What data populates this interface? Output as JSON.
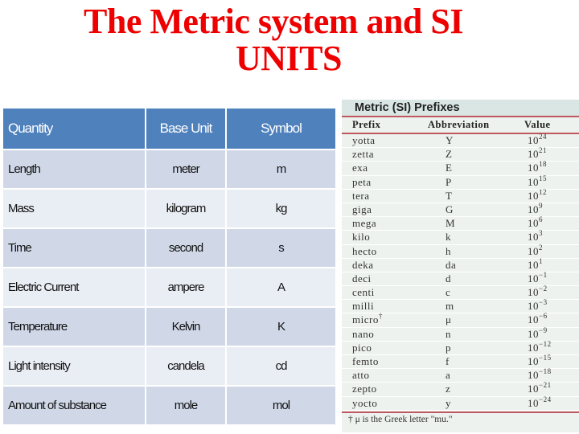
{
  "title": {
    "line1": "The Metric system and SI",
    "line2": "UNITS"
  },
  "colors": {
    "title": "#ee0000",
    "units_header": "#4f81bd",
    "row_dark": "#d0d8e8",
    "row_light": "#e9edf4",
    "prefix_rule": "#c0585f"
  },
  "units_table": {
    "headers": [
      "Quantity",
      "Base Unit",
      "Symbol"
    ],
    "rows": [
      [
        "Length",
        "meter",
        "m"
      ],
      [
        "Mass",
        "kilogram",
        "kg"
      ],
      [
        "Time",
        "second",
        "s"
      ],
      [
        "Electric Current",
        "ampere",
        "A"
      ],
      [
        "Temperature",
        "Kelvin",
        "K"
      ],
      [
        "Light intensity",
        "candela",
        "cd"
      ],
      [
        "Amount of substance",
        "mole",
        "mol"
      ]
    ]
  },
  "prefix_table": {
    "title": "Metric (SI) Prefixes",
    "headers": [
      "Prefix",
      "Abbreviation",
      "Value"
    ],
    "rows": [
      {
        "prefix": "yotta",
        "mark": "",
        "abbr": "Y",
        "base": "10",
        "exp": "24"
      },
      {
        "prefix": "zetta",
        "mark": "",
        "abbr": "Z",
        "base": "10",
        "exp": "21"
      },
      {
        "prefix": "exa",
        "mark": "",
        "abbr": "E",
        "base": "10",
        "exp": "18"
      },
      {
        "prefix": "peta",
        "mark": "",
        "abbr": "P",
        "base": "10",
        "exp": "15"
      },
      {
        "prefix": "tera",
        "mark": "",
        "abbr": "T",
        "base": "10",
        "exp": "12"
      },
      {
        "prefix": "giga",
        "mark": "",
        "abbr": "G",
        "base": "10",
        "exp": "9"
      },
      {
        "prefix": "mega",
        "mark": "",
        "abbr": "M",
        "base": "10",
        "exp": "6"
      },
      {
        "prefix": "kilo",
        "mark": "",
        "abbr": "k",
        "base": "10",
        "exp": "3"
      },
      {
        "prefix": "hecto",
        "mark": "",
        "abbr": "h",
        "base": "10",
        "exp": "2"
      },
      {
        "prefix": "deka",
        "mark": "",
        "abbr": "da",
        "base": "10",
        "exp": "1"
      },
      {
        "prefix": "deci",
        "mark": "",
        "abbr": "d",
        "base": "10",
        "exp": "−1"
      },
      {
        "prefix": "centi",
        "mark": "",
        "abbr": "c",
        "base": "10",
        "exp": "−2"
      },
      {
        "prefix": "milli",
        "mark": "",
        "abbr": "m",
        "base": "10",
        "exp": "−3"
      },
      {
        "prefix": "micro",
        "mark": "†",
        "abbr": "μ",
        "base": "10",
        "exp": "−6"
      },
      {
        "prefix": "nano",
        "mark": "",
        "abbr": "n",
        "base": "10",
        "exp": "−9"
      },
      {
        "prefix": "pico",
        "mark": "",
        "abbr": "p",
        "base": "10",
        "exp": "−12"
      },
      {
        "prefix": "femto",
        "mark": "",
        "abbr": "f",
        "base": "10",
        "exp": "−15"
      },
      {
        "prefix": "atto",
        "mark": "",
        "abbr": "a",
        "base": "10",
        "exp": "−18"
      },
      {
        "prefix": "zepto",
        "mark": "",
        "abbr": "z",
        "base": "10",
        "exp": "−21"
      },
      {
        "prefix": "yocto",
        "mark": "",
        "abbr": "y",
        "base": "10",
        "exp": "−24"
      }
    ],
    "footnote": "† μ is the Greek letter \"mu.\""
  }
}
